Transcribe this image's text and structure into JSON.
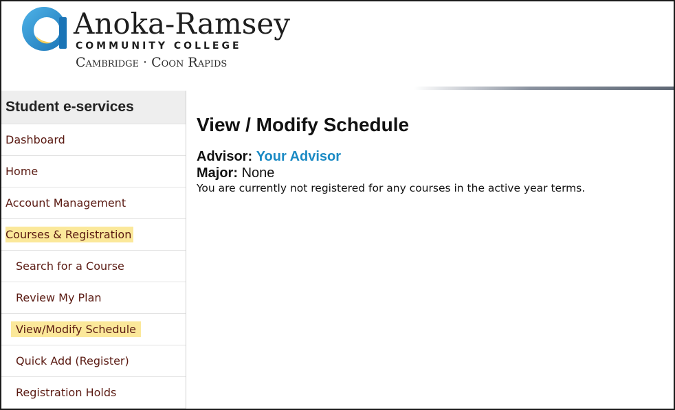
{
  "college": {
    "name": "Anoka-Ramsey",
    "subtitle": "COMMUNITY COLLEGE",
    "campuses": "Cambridge · Coon Rapids",
    "logo_icon": "stylized-a-sun-icon",
    "colors": {
      "logo_blue": "#1f89c9",
      "logo_gold": "#f2c744",
      "logo_dark": "#1e1e1e"
    }
  },
  "sidebar": {
    "title": "Student e-services",
    "items": [
      {
        "label": "Dashboard",
        "level": "top",
        "highlighted": false
      },
      {
        "label": "Home",
        "level": "top",
        "highlighted": false
      },
      {
        "label": "Account Management",
        "level": "top",
        "highlighted": false
      },
      {
        "label": "Courses & Registration",
        "level": "top",
        "highlighted": true
      },
      {
        "label": "Search for a Course",
        "level": "sub",
        "highlighted": false
      },
      {
        "label": "Review My Plan",
        "level": "sub",
        "highlighted": false
      },
      {
        "label": "View/Modify Schedule",
        "level": "sub",
        "highlighted": true
      },
      {
        "label": "Quick Add (Register)",
        "level": "sub",
        "highlighted": false
      },
      {
        "label": "Registration Holds",
        "level": "sub",
        "highlighted": false
      }
    ],
    "colors": {
      "item_text": "#5a1a12",
      "highlight": "#fbe89a",
      "title_bg": "#eeeeee"
    }
  },
  "main": {
    "title": "View / Modify Schedule",
    "advisor_label": "Advisor:",
    "advisor_value": "Your Advisor",
    "major_label": "Major:",
    "major_value": "None",
    "notice": "You are currently not registered for any courses in the active year terms.",
    "colors": {
      "link": "#1a8ac4"
    }
  }
}
